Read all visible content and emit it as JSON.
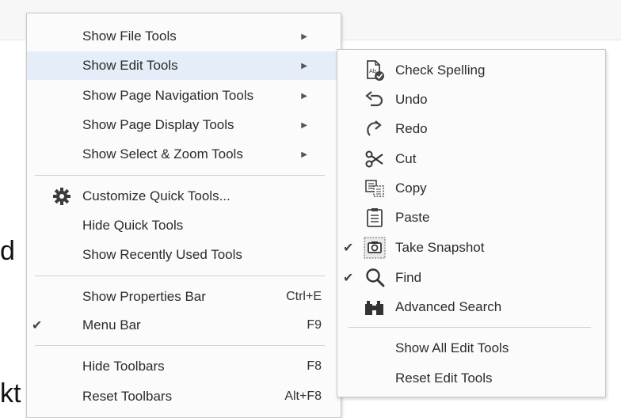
{
  "background": {
    "fragment_top": "d",
    "fragment_bottom": "kt"
  },
  "main_menu": {
    "items": [
      {
        "label": "Show File Tools",
        "has_submenu": true
      },
      {
        "label": "Show Edit Tools",
        "has_submenu": true,
        "highlighted": true
      },
      {
        "label": "Show Page Navigation Tools",
        "has_submenu": true
      },
      {
        "label": "Show Page Display Tools",
        "has_submenu": true
      },
      {
        "label": "Show Select & Zoom Tools",
        "has_submenu": true
      },
      {
        "label": "Customize Quick Tools...",
        "icon": "gear-icon"
      },
      {
        "label": "Hide Quick Tools"
      },
      {
        "label": "Show Recently Used Tools"
      },
      {
        "label": "Show Properties Bar",
        "shortcut": "Ctrl+E"
      },
      {
        "label": "Menu Bar",
        "shortcut": "F9",
        "checked": true
      },
      {
        "label": "Hide Toolbars",
        "shortcut": "F8"
      },
      {
        "label": "Reset Toolbars",
        "shortcut": "Alt+F8"
      }
    ],
    "check_glyph": "✔",
    "arrow_glyph": "▶"
  },
  "edit_submenu": {
    "items": [
      {
        "label": "Check Spelling",
        "icon": "spellcheck-icon"
      },
      {
        "label": "Undo",
        "icon": "undo-icon"
      },
      {
        "label": "Redo",
        "icon": "redo-icon"
      },
      {
        "label": "Cut",
        "icon": "scissors-icon"
      },
      {
        "label": "Copy",
        "icon": "copy-icon"
      },
      {
        "label": "Paste",
        "icon": "paste-icon"
      },
      {
        "label": "Take Snapshot",
        "icon": "camera-icon",
        "checked": true
      },
      {
        "label": "Find",
        "icon": "search-icon",
        "checked": true
      },
      {
        "label": "Advanced Search",
        "icon": "binoculars-icon"
      },
      {
        "label": "Show All Edit Tools"
      },
      {
        "label": "Reset Edit Tools"
      }
    ]
  }
}
